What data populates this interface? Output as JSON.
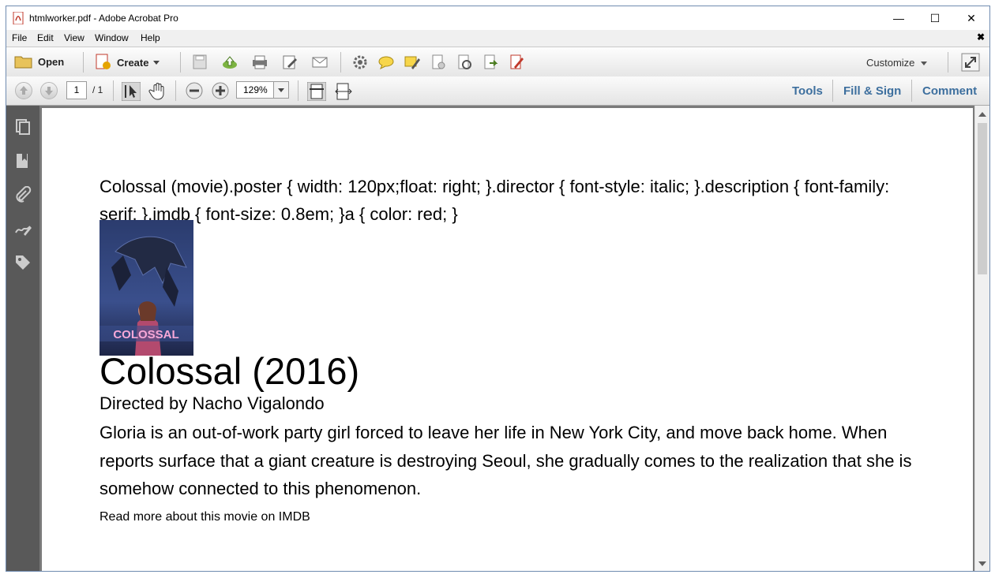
{
  "window": {
    "title": "htmlworker.pdf - Adobe Acrobat Pro",
    "minimize_glyph": "—",
    "maximize_glyph": "☐",
    "close_glyph": "✕"
  },
  "menu": {
    "items": [
      "File",
      "Edit",
      "View",
      "Window",
      "Help"
    ],
    "close_glyph": "✖"
  },
  "toolbar": {
    "open_label": "Open",
    "create_label": "Create",
    "customize_label": "Customize",
    "icons": [
      "save-icon",
      "upload-icon",
      "print-icon",
      "edit-icon",
      "email-icon",
      "settings-icon",
      "comment-icon",
      "highlight-icon",
      "attach-icon",
      "stamp-icon",
      "export-icon",
      "sign-icon"
    ]
  },
  "nav": {
    "page_current": "1",
    "page_total": "/ 1",
    "zoom": "129%"
  },
  "panels": {
    "tools": "Tools",
    "fill_sign": "Fill & Sign",
    "comment": "Comment"
  },
  "document": {
    "css_text": "Colossal (movie).poster { width: 120px;float: right; }.director { font-style: italic; }.description { font-family: serif; }.imdb { font-size: 0.8em; }a { color: red; }",
    "poster_text": "COLOSSAL",
    "movie_title": "Colossal (2016)",
    "director": "Directed by Nacho Vigalondo",
    "description": "Gloria is an out-of-work party girl forced to leave her life in New York City, and move back home. When reports surface that a giant creature is destroying Seoul, she gradually comes to the realization that she is somehow connected to this phenomenon.",
    "imdb_link": "Read more about this movie on IMDB"
  },
  "colors": {
    "accent": "#3d6f9e",
    "nav_pane": "#595959",
    "doc_background": "#7a7a7a"
  }
}
